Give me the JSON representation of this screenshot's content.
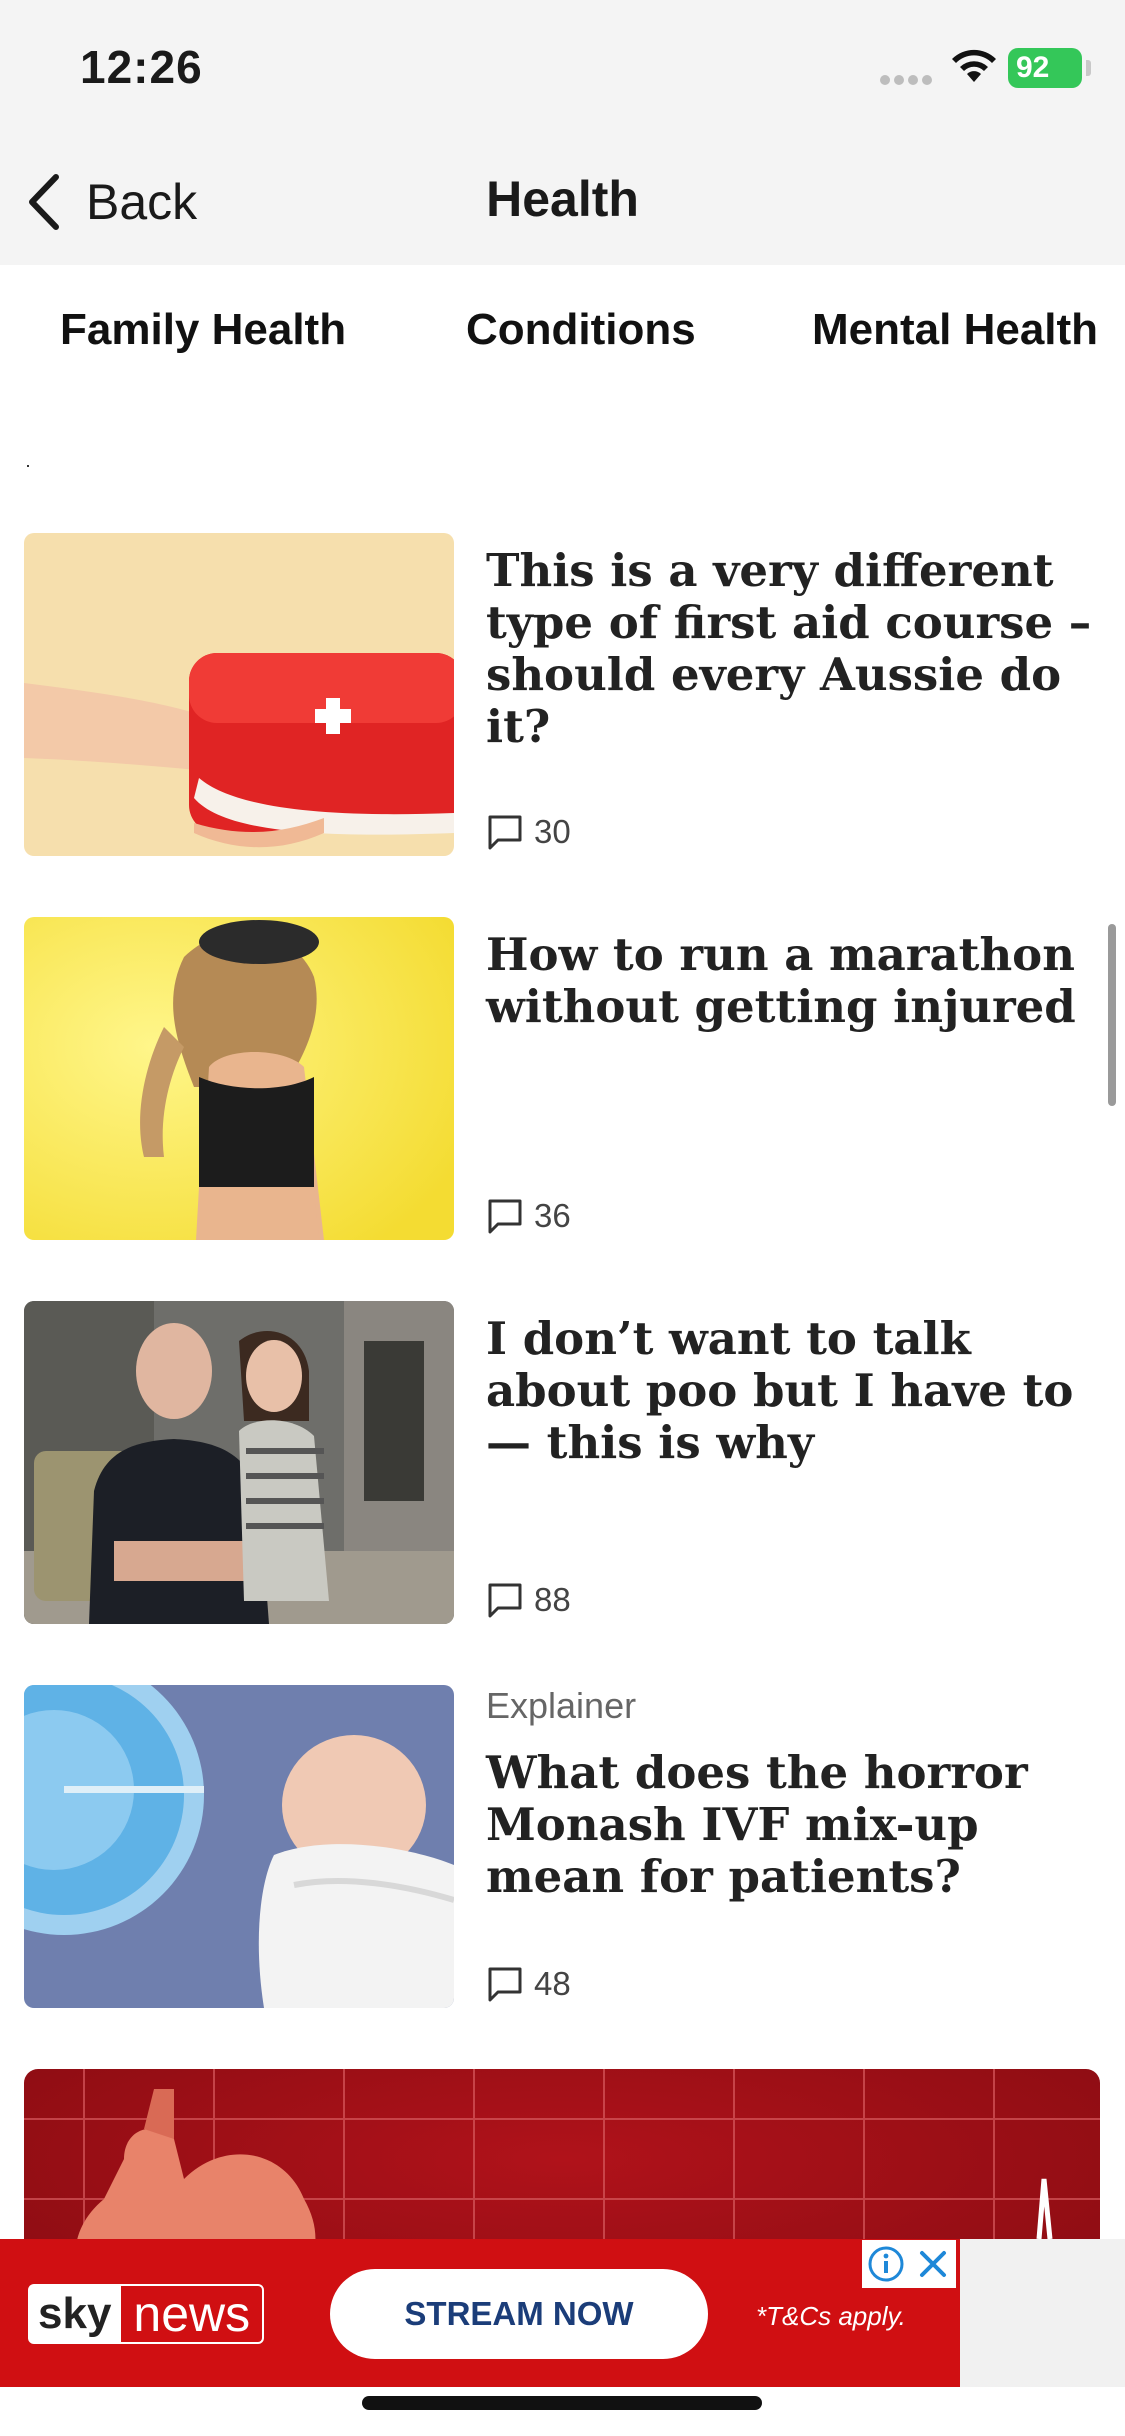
{
  "status_bar": {
    "time": "12:26",
    "battery": "92"
  },
  "nav": {
    "back_label": "Back",
    "title": "Health"
  },
  "tabs": [
    {
      "label": "Family Health"
    },
    {
      "label": "Conditions"
    },
    {
      "label": "Mental Health"
    }
  ],
  "articles": [
    {
      "kicker": "",
      "headline": "This is a very different type of first aid course – should every Aussie do it?",
      "comments": "30",
      "image": "first-aid-kit"
    },
    {
      "kicker": "",
      "headline": "How to run a marathon without getting injured",
      "comments": "36",
      "image": "runner"
    },
    {
      "kicker": "",
      "headline": "I don’t want to talk about poo but I have to — this is why",
      "comments": "88",
      "image": "father-and-daughter"
    },
    {
      "kicker": "Explainer",
      "headline": "What does the horror Monash IVF mix-up mean for patients?",
      "comments": "48",
      "image": "ivf-baby"
    }
  ],
  "ad": {
    "brand_sky": "sky",
    "brand_news": "news",
    "cta": "STREAM NOW",
    "terms": "*T&Cs apply."
  },
  "colors": {
    "ad_red": "#d00f12",
    "battery_green": "#34c759",
    "cta_blue": "#1b3d79"
  }
}
